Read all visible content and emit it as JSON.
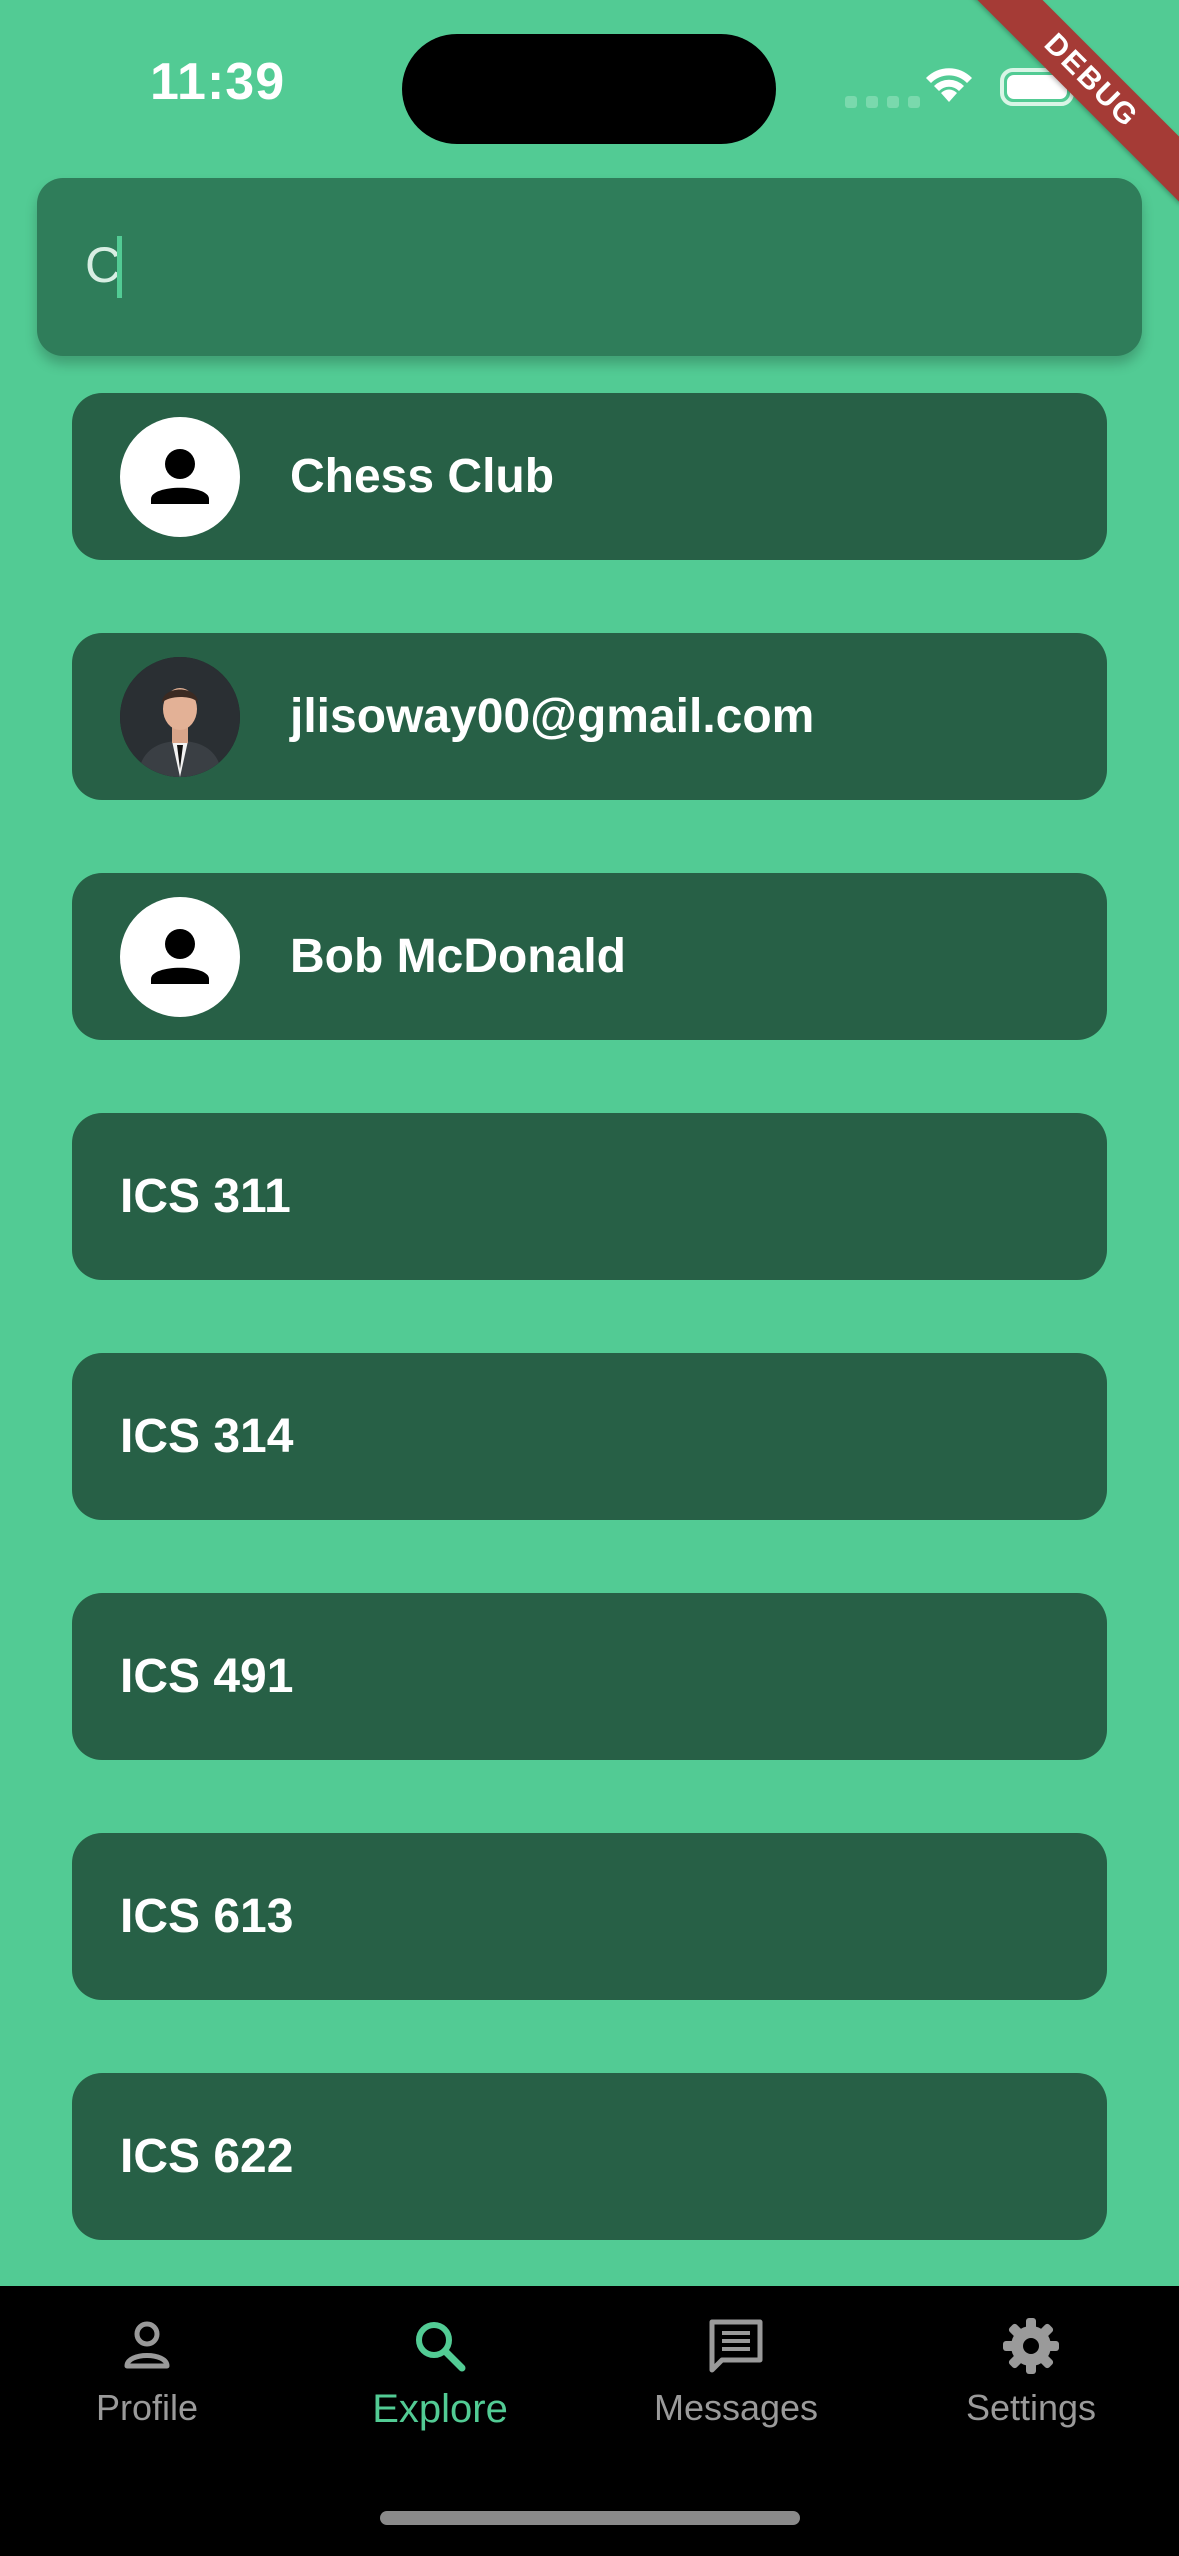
{
  "status_bar": {
    "time": "11:39",
    "debug_label": "DEBUG"
  },
  "search": {
    "value": "C"
  },
  "results": [
    {
      "label": "Chess Club",
      "avatar": "person-icon"
    },
    {
      "label": "jlisoway00@gmail.com",
      "avatar": "profile-photo"
    },
    {
      "label": "Bob McDonald",
      "avatar": "person-icon"
    },
    {
      "label": "ICS 311",
      "avatar": "none"
    },
    {
      "label": "ICS 314",
      "avatar": "none"
    },
    {
      "label": "ICS 491",
      "avatar": "none"
    },
    {
      "label": "ICS 613",
      "avatar": "none"
    },
    {
      "label": "ICS 622",
      "avatar": "none"
    }
  ],
  "bottom_nav": {
    "profile": "Profile",
    "explore": "Explore",
    "messages": "Messages",
    "settings": "Settings",
    "active": "explore"
  },
  "colors": {
    "background": "#52cb94",
    "card": "#276046",
    "search_box": "#2f7d5a",
    "accent": "#52cb94",
    "debug_banner": "#a53b36"
  }
}
